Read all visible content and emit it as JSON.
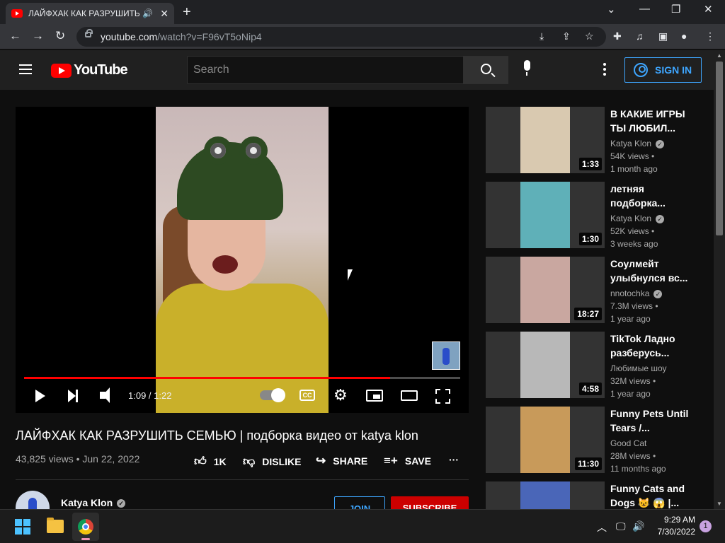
{
  "browser": {
    "tab_title": "ЛАЙФХАК КАК РАЗРУШИТЬ",
    "tab_audio_icon": "speaker-icon",
    "tab_close": "✕",
    "new_tab": "+",
    "url_host": "youtube.com",
    "url_path": "/watch?v=F96vT5oNip4"
  },
  "header": {
    "logo_text": "YouTube",
    "search_placeholder": "Search",
    "signin_label": "SIGN IN"
  },
  "player": {
    "time": "1:09 / 1:22",
    "cc_label": "CC",
    "progress": 0.84
  },
  "video": {
    "title": "ЛАЙФХАК КАК РАЗРУШИТЬ СЕМЬЮ | подборка видео от katya klon",
    "meta": "43,825 views • Jun 22, 2022",
    "like_label": "1K",
    "dislike_label": "DISLIKE",
    "share_label": "SHARE",
    "save_label": "SAVE",
    "channel_name": "Katya Klon",
    "join_label": "JOIN",
    "subscribe_label": "SUBSCRIBE"
  },
  "recommendations": [
    {
      "title": "В КАКИЕ ИГРЫ ТЫ ЛЮБИЛ...",
      "channel": "Katya Klon",
      "verified": true,
      "views": "54K views •",
      "age": "1 month ago",
      "duration": "1:33",
      "color": "#d9c9b0"
    },
    {
      "title": "летняя подборка...",
      "channel": "Katya Klon",
      "verified": true,
      "views": "52K views •",
      "age": "3 weeks ago",
      "duration": "1:30",
      "color": "#5fb0b8"
    },
    {
      "title": "Соулмейт улыбнулся вс...",
      "channel": "nnotochka",
      "verified": true,
      "views": "7.3M views •",
      "age": "1 year ago",
      "duration": "18:27",
      "color": "#c9a7a0"
    },
    {
      "title": "TikTok Ладно разберусь...",
      "channel": "Любимые шоу",
      "verified": false,
      "views": "32M views •",
      "age": "1 year ago",
      "duration": "4:58",
      "color": "#b8b8b8"
    },
    {
      "title": "Funny Pets Until Tears /...",
      "channel": "Good Cat",
      "verified": false,
      "views": "28M views •",
      "age": "11 months ago",
      "duration": "11:30",
      "color": "#c89a5a"
    },
    {
      "title": "Funny Cats and Dogs 😺 😱 |...",
      "channel": "",
      "verified": false,
      "views": "",
      "age": "",
      "duration": "",
      "color": "#4a66b8"
    }
  ],
  "taskbar": {
    "time": "9:29 AM",
    "date": "7/30/2022",
    "notification_count": "1"
  }
}
